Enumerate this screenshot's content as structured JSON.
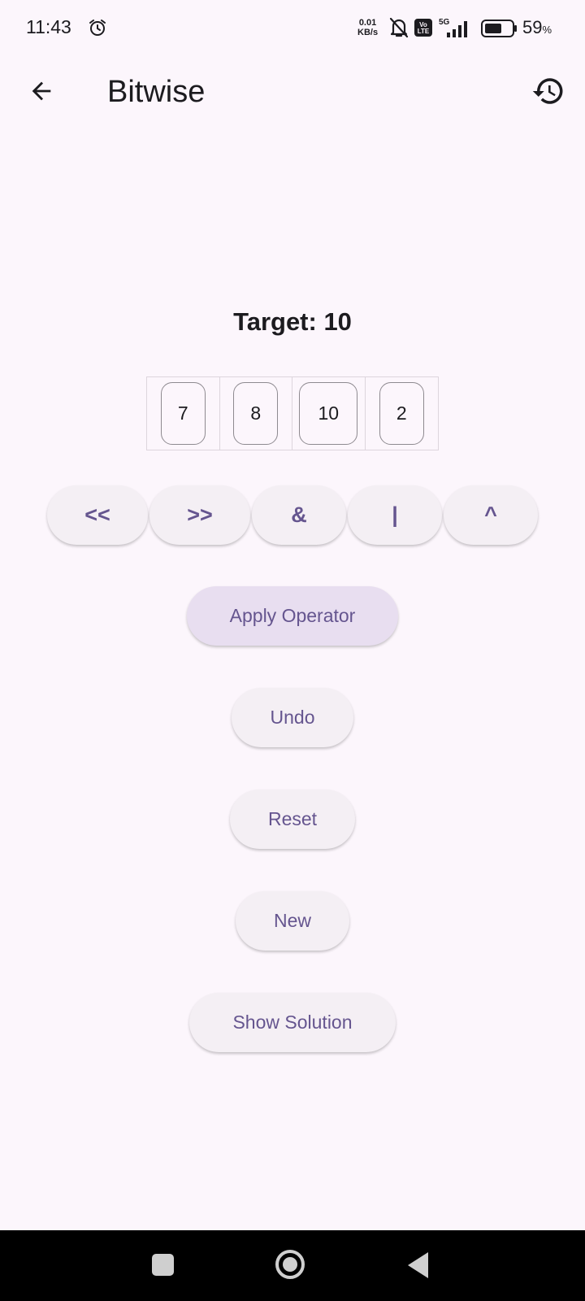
{
  "status_bar": {
    "time": "11:43",
    "net_speed_value": "0.01",
    "net_speed_unit": "KB/s",
    "volte_top": "Vo",
    "volte_bottom": "LTE",
    "network": "5G",
    "battery_percent": "59",
    "battery_unit": "%",
    "icons": [
      "alarm-icon",
      "mute-icon",
      "volte-icon",
      "signal-icon",
      "battery-icon"
    ]
  },
  "app_bar": {
    "title": "Bitwise",
    "back_icon": "arrow-back-icon",
    "history_icon": "history-icon"
  },
  "game": {
    "target_label": "Target: 10",
    "numbers": [
      "7",
      "8",
      "10",
      "2"
    ],
    "operators": [
      "<<",
      ">>",
      "&",
      "|",
      "^"
    ]
  },
  "actions": {
    "apply": "Apply Operator",
    "undo": "Undo",
    "reset": "Reset",
    "new": "New",
    "show_solution": "Show Solution"
  },
  "nav_bar": {
    "icons": [
      "recents-icon",
      "home-icon",
      "back-icon"
    ]
  },
  "colors": {
    "background": "#FCF6FC",
    "accent": "#65558F",
    "button_bg": "#F4EFF4",
    "primary_button_bg": "#E8DEF0"
  }
}
